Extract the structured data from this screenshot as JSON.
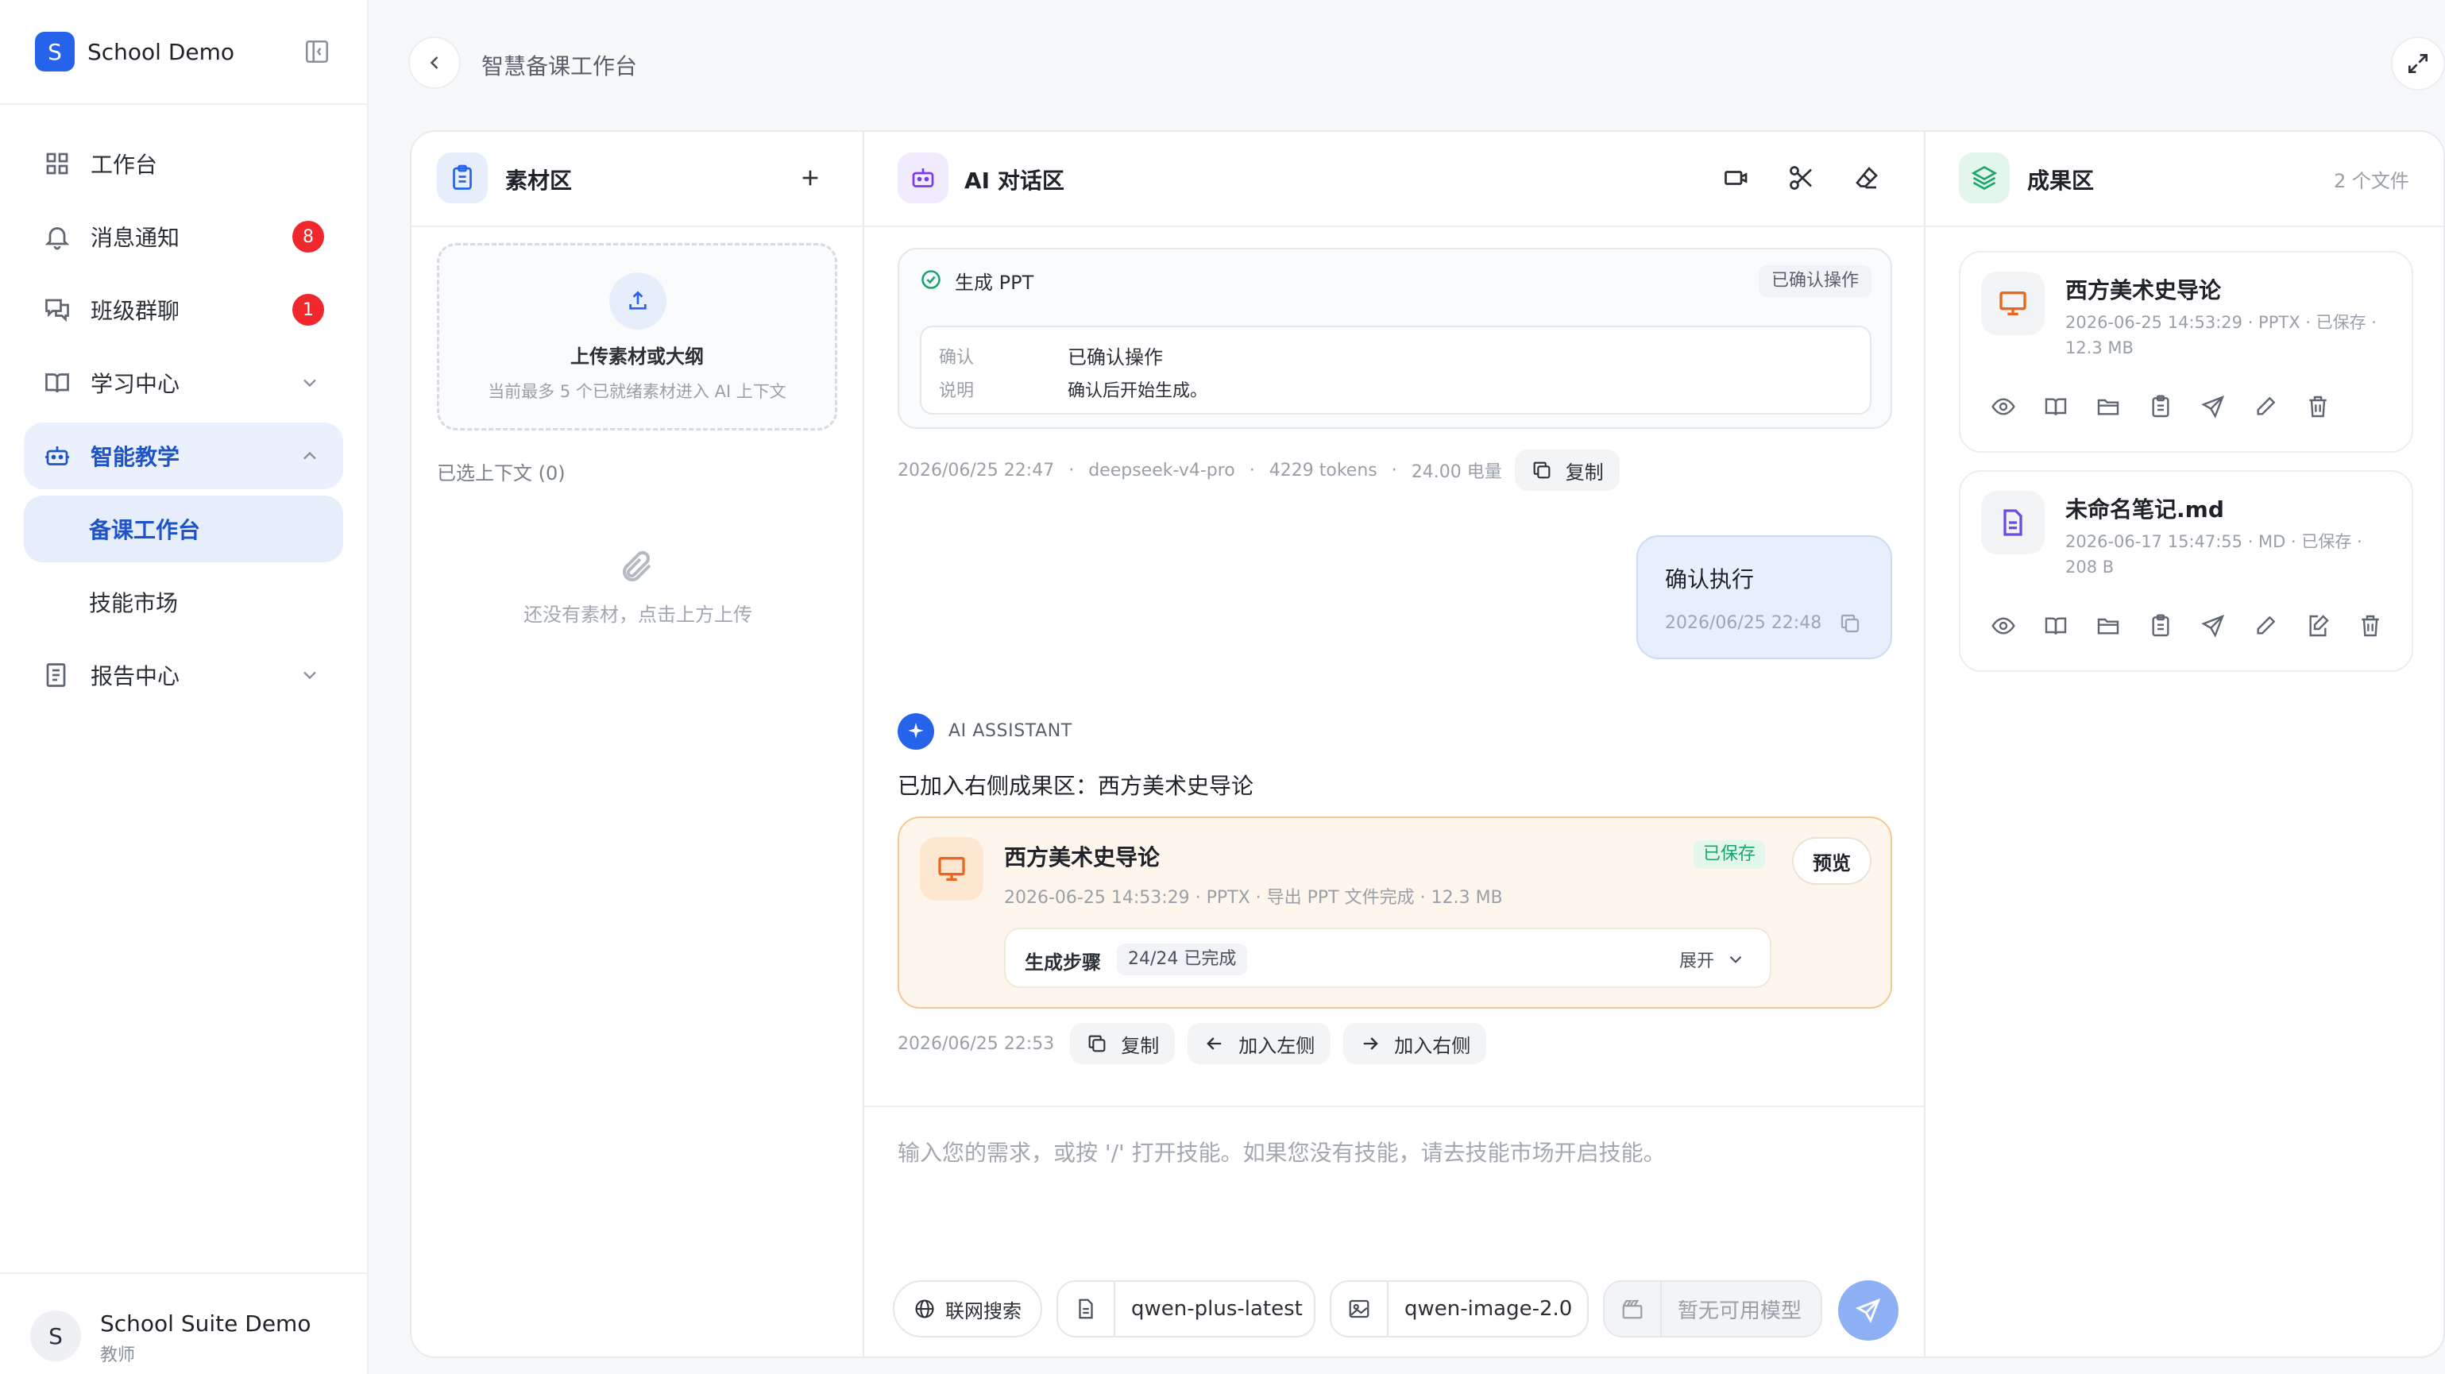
{
  "app": {
    "logo_letter": "S",
    "name": "School Demo"
  },
  "nav": {
    "workbench": "工作台",
    "notifications": "消息通知",
    "notifications_badge": "8",
    "class_chat": "班级群聊",
    "class_chat_badge": "1",
    "learning_center": "学习中心",
    "smart_teaching": "智能教学",
    "lesson_workbench": "备课工作台",
    "skill_market": "技能市场",
    "report_center": "报告中心"
  },
  "user": {
    "avatar_letter": "S",
    "name": "School Suite Demo",
    "role": "教师"
  },
  "header": {
    "title": "智慧备课工作台"
  },
  "materials": {
    "title": "素材区",
    "upload_title": "上传素材或大纲",
    "upload_sub": "当前最多 5 个已就绪素材进入 AI 上下文",
    "context_label": "已选上下文 (0)",
    "empty_text": "还没有素材，点击上方上传"
  },
  "chat": {
    "title": "AI 对话区",
    "confirm_card": {
      "title": "生成 PPT",
      "tag": "已确认操作",
      "k1": "确认",
      "v1": "已确认操作",
      "k2": "说明",
      "v2": "确认后开始生成。"
    },
    "meta1": {
      "time": "2026/06/25 22:47",
      "model": "deepseek-v4-pro",
      "tokens": "4229 tokens",
      "power": "24.00 电量",
      "copy": "复制"
    },
    "user_msg": {
      "text": "确认执行",
      "time": "2026/06/25 22:48"
    },
    "assistant_label": "AI ASSISTANT",
    "assistant_text": "已加入右侧成果区：西方美术史导论",
    "result_card": {
      "title": "西方美术史导论",
      "sub": "2026-06-25 14:53:29 · PPTX · 导出 PPT 文件完成 · 12.3 MB",
      "tag": "已保存",
      "preview": "预览",
      "steps_label": "生成步骤",
      "steps_count": "24/24 已完成",
      "expand": "展开"
    },
    "meta2": {
      "time": "2026/06/25 22:53",
      "copy": "复制",
      "add_left": "加入左侧",
      "add_right": "加入右侧"
    },
    "input_placeholder": "输入您的需求，或按 '/' 打开技能。如果您没有技能，请去技能市场开启技能。",
    "web_search": "联网搜索",
    "text_model": "qwen-plus-latest",
    "image_model": "qwen-image-2.0",
    "video_model": "暂无可用模型"
  },
  "results": {
    "title": "成果区",
    "count": "2 个文件",
    "files": [
      {
        "title": "西方美术史导论",
        "sub": "2026-06-25 14:53:29 · PPTX · 已保存 · 12.3 MB",
        "icon": "presentation-icon",
        "color": "#e8671c"
      },
      {
        "title": "未命名笔记.md",
        "sub": "2026-06-17 15:47:55 · MD · 已保存 · 208 B",
        "icon": "document-icon",
        "color": "#6d4de0"
      }
    ]
  }
}
